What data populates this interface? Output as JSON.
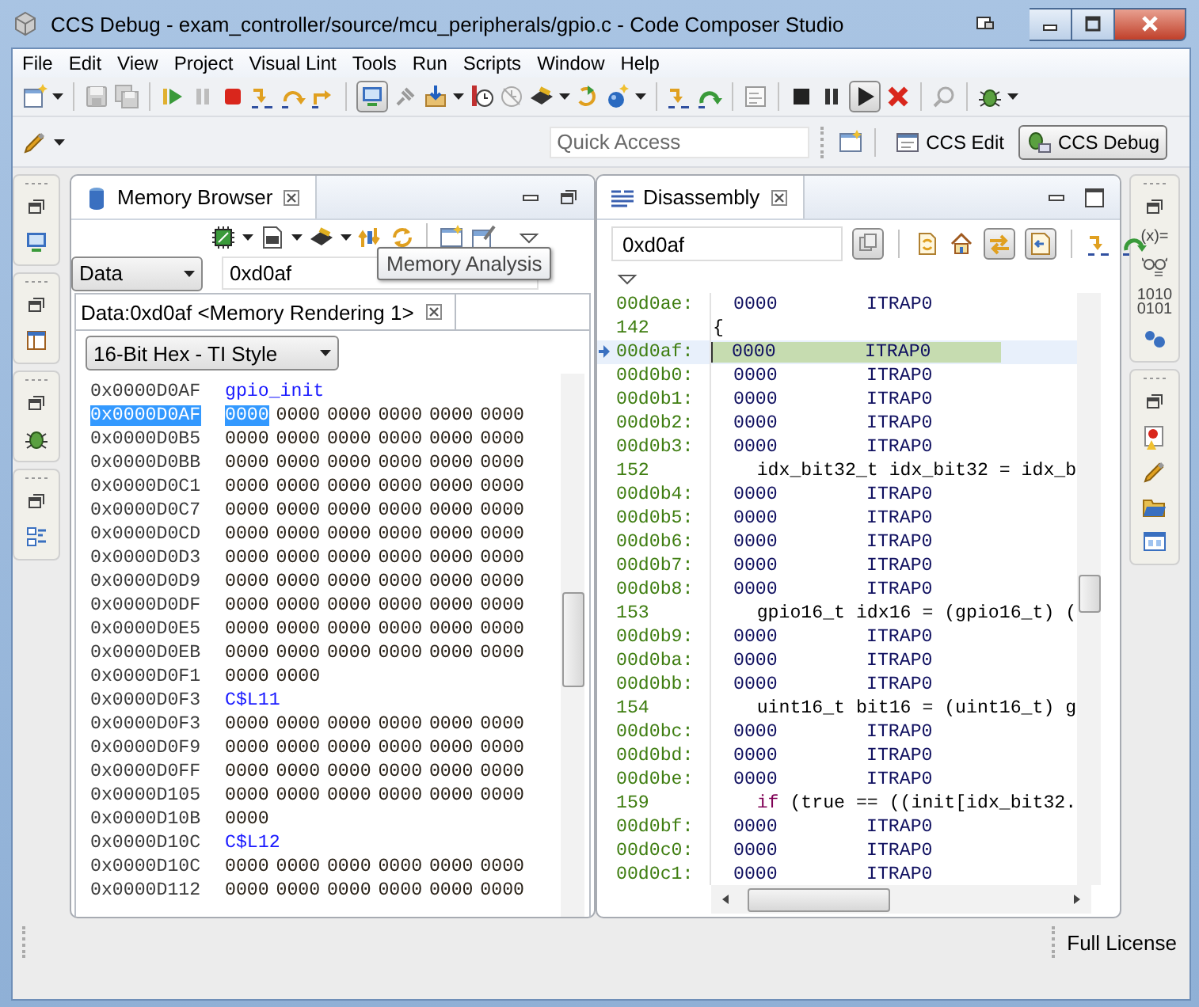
{
  "window": {
    "title": "CCS Debug - exam_controller/source/mcu_peripherals/gpio.c - Code Composer Studio"
  },
  "menu": [
    "File",
    "Edit",
    "View",
    "Project",
    "Visual Lint",
    "Tools",
    "Run",
    "Scripts",
    "Window",
    "Help"
  ],
  "toolbar": {
    "quick_access": {
      "placeholder": "Quick Access"
    },
    "perspectives": [
      {
        "label": "CCS Edit",
        "selected": false
      },
      {
        "label": "CCS Debug",
        "selected": true
      }
    ]
  },
  "memory_browser": {
    "tab": "Memory Browser",
    "memory_page": "Data",
    "address": "0xd0af",
    "tooltip": "Memory Analysis",
    "rendering_tab": "Data:0xd0af <Memory Rendering 1>",
    "format": "16-Bit Hex - TI Style",
    "rows": [
      {
        "kind": "label",
        "address": "0x0000D0AF",
        "text": "gpio_init",
        "selected": false
      },
      {
        "kind": "data",
        "address": "0x0000D0AF",
        "words": [
          "0000",
          "0000",
          "0000",
          "0000",
          "0000",
          "0000"
        ],
        "selected": true
      },
      {
        "kind": "data",
        "address": "0x0000D0B5",
        "words": [
          "0000",
          "0000",
          "0000",
          "0000",
          "0000",
          "0000"
        ],
        "selected": false
      },
      {
        "kind": "data",
        "address": "0x0000D0BB",
        "words": [
          "0000",
          "0000",
          "0000",
          "0000",
          "0000",
          "0000"
        ],
        "selected": false
      },
      {
        "kind": "data",
        "address": "0x0000D0C1",
        "words": [
          "0000",
          "0000",
          "0000",
          "0000",
          "0000",
          "0000"
        ],
        "selected": false
      },
      {
        "kind": "data",
        "address": "0x0000D0C7",
        "words": [
          "0000",
          "0000",
          "0000",
          "0000",
          "0000",
          "0000"
        ],
        "selected": false
      },
      {
        "kind": "data",
        "address": "0x0000D0CD",
        "words": [
          "0000",
          "0000",
          "0000",
          "0000",
          "0000",
          "0000"
        ],
        "selected": false
      },
      {
        "kind": "data",
        "address": "0x0000D0D3",
        "words": [
          "0000",
          "0000",
          "0000",
          "0000",
          "0000",
          "0000"
        ],
        "selected": false
      },
      {
        "kind": "data",
        "address": "0x0000D0D9",
        "words": [
          "0000",
          "0000",
          "0000",
          "0000",
          "0000",
          "0000"
        ],
        "selected": false
      },
      {
        "kind": "data",
        "address": "0x0000D0DF",
        "words": [
          "0000",
          "0000",
          "0000",
          "0000",
          "0000",
          "0000"
        ],
        "selected": false
      },
      {
        "kind": "data",
        "address": "0x0000D0E5",
        "words": [
          "0000",
          "0000",
          "0000",
          "0000",
          "0000",
          "0000"
        ],
        "selected": false
      },
      {
        "kind": "data",
        "address": "0x0000D0EB",
        "words": [
          "0000",
          "0000",
          "0000",
          "0000",
          "0000",
          "0000"
        ],
        "selected": false
      },
      {
        "kind": "data",
        "address": "0x0000D0F1",
        "words": [
          "0000",
          "0000"
        ],
        "selected": false
      },
      {
        "kind": "label",
        "address": "0x0000D0F3",
        "text": "C$L11",
        "selected": false
      },
      {
        "kind": "data",
        "address": "0x0000D0F3",
        "words": [
          "0000",
          "0000",
          "0000",
          "0000",
          "0000",
          "0000"
        ],
        "selected": false
      },
      {
        "kind": "data",
        "address": "0x0000D0F9",
        "words": [
          "0000",
          "0000",
          "0000",
          "0000",
          "0000",
          "0000"
        ],
        "selected": false
      },
      {
        "kind": "data",
        "address": "0x0000D0FF",
        "words": [
          "0000",
          "0000",
          "0000",
          "0000",
          "0000",
          "0000"
        ],
        "selected": false
      },
      {
        "kind": "data",
        "address": "0x0000D105",
        "words": [
          "0000",
          "0000",
          "0000",
          "0000",
          "0000",
          "0000"
        ],
        "selected": false
      },
      {
        "kind": "data",
        "address": "0x0000D10B",
        "words": [
          "0000"
        ],
        "selected": false
      },
      {
        "kind": "label",
        "address": "0x0000D10C",
        "text": "C$L12",
        "selected": false
      },
      {
        "kind": "data",
        "address": "0x0000D10C",
        "words": [
          "0000",
          "0000",
          "0000",
          "0000",
          "0000",
          "0000"
        ],
        "selected": false
      },
      {
        "kind": "data",
        "address": "0x0000D112",
        "words": [
          "0000",
          "0000",
          "0000",
          "0000",
          "0000",
          "0000"
        ],
        "selected": false
      }
    ]
  },
  "disassembly": {
    "tab": "Disassembly",
    "address": "0xd0af",
    "rows": [
      {
        "kind": "instr",
        "address": "00d0ae:",
        "opcode": "0000",
        "mnemonic": "ITRAP0",
        "current": false
      },
      {
        "kind": "source",
        "line": "142",
        "code": [
          {
            "kind": "plain",
            "text": "{"
          }
        ]
      },
      {
        "kind": "instr",
        "address": "00d0af:",
        "opcode": "0000",
        "mnemonic": "ITRAP0",
        "current": true
      },
      {
        "kind": "instr",
        "address": "00d0b0:",
        "opcode": "0000",
        "mnemonic": "ITRAP0",
        "current": false
      },
      {
        "kind": "instr",
        "address": "00d0b1:",
        "opcode": "0000",
        "mnemonic": "ITRAP0",
        "current": false
      },
      {
        "kind": "instr",
        "address": "00d0b2:",
        "opcode": "0000",
        "mnemonic": "ITRAP0",
        "current": false
      },
      {
        "kind": "instr",
        "address": "00d0b3:",
        "opcode": "0000",
        "mnemonic": "ITRAP0",
        "current": false
      },
      {
        "kind": "source",
        "line": "152",
        "code": [
          {
            "kind": "plain",
            "text": "    idx_bit32_t idx_bit32 = idx_b"
          }
        ]
      },
      {
        "kind": "instr",
        "address": "00d0b4:",
        "opcode": "0000",
        "mnemonic": "ITRAP0",
        "current": false
      },
      {
        "kind": "instr",
        "address": "00d0b5:",
        "opcode": "0000",
        "mnemonic": "ITRAP0",
        "current": false
      },
      {
        "kind": "instr",
        "address": "00d0b6:",
        "opcode": "0000",
        "mnemonic": "ITRAP0",
        "current": false
      },
      {
        "kind": "instr",
        "address": "00d0b7:",
        "opcode": "0000",
        "mnemonic": "ITRAP0",
        "current": false
      },
      {
        "kind": "instr",
        "address": "00d0b8:",
        "opcode": "0000",
        "mnemonic": "ITRAP0",
        "current": false
      },
      {
        "kind": "source",
        "line": "153",
        "code": [
          {
            "kind": "plain",
            "text": "    gpio16_t idx16 = (gpio16_t) ("
          }
        ]
      },
      {
        "kind": "instr",
        "address": "00d0b9:",
        "opcode": "0000",
        "mnemonic": "ITRAP0",
        "current": false
      },
      {
        "kind": "instr",
        "address": "00d0ba:",
        "opcode": "0000",
        "mnemonic": "ITRAP0",
        "current": false
      },
      {
        "kind": "instr",
        "address": "00d0bb:",
        "opcode": "0000",
        "mnemonic": "ITRAP0",
        "current": false
      },
      {
        "kind": "source",
        "line": "154",
        "code": [
          {
            "kind": "plain",
            "text": "    uint16_t bit16 = (uint16_t) g"
          }
        ]
      },
      {
        "kind": "instr",
        "address": "00d0bc:",
        "opcode": "0000",
        "mnemonic": "ITRAP0",
        "current": false
      },
      {
        "kind": "instr",
        "address": "00d0bd:",
        "opcode": "0000",
        "mnemonic": "ITRAP0",
        "current": false
      },
      {
        "kind": "instr",
        "address": "00d0be:",
        "opcode": "0000",
        "mnemonic": "ITRAP0",
        "current": false
      },
      {
        "kind": "source",
        "line": "159",
        "code": [
          {
            "kind": "keyword",
            "text": "    if"
          },
          {
            "kind": "plain",
            "text": " (true == ((init[idx_bit32."
          }
        ]
      },
      {
        "kind": "instr",
        "address": "00d0bf:",
        "opcode": "0000",
        "mnemonic": "ITRAP0",
        "current": false
      },
      {
        "kind": "instr",
        "address": "00d0c0:",
        "opcode": "0000",
        "mnemonic": "ITRAP0",
        "current": false
      },
      {
        "kind": "instr",
        "address": "00d0c1:",
        "opcode": "0000",
        "mnemonic": "ITRAP0",
        "current": false
      }
    ]
  },
  "right_trim": {
    "variables_label": "(x)=",
    "registers_label": [
      "1010",
      "0101"
    ]
  },
  "status_bar": {
    "license": "Full License"
  }
}
